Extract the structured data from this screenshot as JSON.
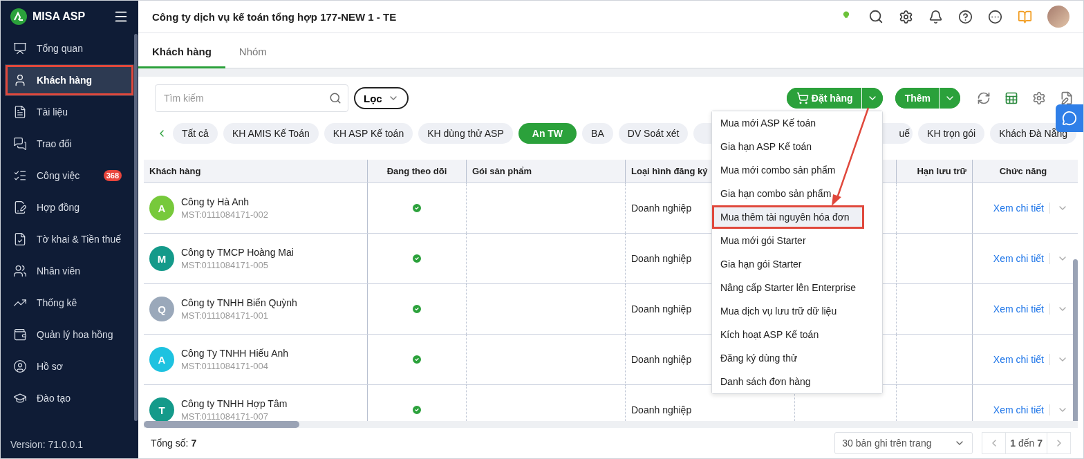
{
  "brand": "MISA ASP",
  "company": "Công ty dịch vụ kế toán tổng hợp 177-NEW 1 - TE",
  "sidebar": {
    "items": [
      {
        "label": "Tổng quan",
        "selected": false
      },
      {
        "label": "Khách hàng",
        "selected": true
      },
      {
        "label": "Tài liệu",
        "selected": false
      },
      {
        "label": "Trao đổi",
        "selected": false
      },
      {
        "label": "Công việc",
        "selected": false,
        "badge": "368"
      },
      {
        "label": "Hợp đồng",
        "selected": false
      },
      {
        "label": "Tờ khai & Tiền thuế",
        "selected": false
      },
      {
        "label": "Nhân viên",
        "selected": false
      },
      {
        "label": "Thống kê",
        "selected": false
      },
      {
        "label": "Quản lý hoa hồng",
        "selected": false
      },
      {
        "label": "Hồ sơ",
        "selected": false
      },
      {
        "label": "Đào tạo",
        "selected": false
      }
    ],
    "version": "Version: 71.0.0.1"
  },
  "tabs": [
    {
      "label": "Khách hàng",
      "selected": true
    },
    {
      "label": "Nhóm",
      "selected": false
    }
  ],
  "search": {
    "placeholder": "Tìm kiếm"
  },
  "filter_button": "Lọc",
  "order_button": "Đặt hàng",
  "add_button": "Thêm",
  "chips": [
    {
      "label": "Tất cả",
      "selected": false
    },
    {
      "label": "KH AMIS Kế Toán",
      "selected": false
    },
    {
      "label": "KH ASP Kế toán",
      "selected": false
    },
    {
      "label": "KH dùng thử ASP",
      "selected": false
    },
    {
      "label": "An TW",
      "selected": true
    },
    {
      "label": "BA",
      "selected": false
    },
    {
      "label": "DV Soát xét",
      "selected": false
    },
    {
      "label": "uế",
      "selected": false,
      "kind": "covered"
    },
    {
      "label": "KH trọn gói",
      "selected": false
    },
    {
      "label": "Khách Đà Nẵng",
      "selected": false
    }
  ],
  "table": {
    "columns": [
      "Khách hàng",
      "Đang theo dõi",
      "Gói sản phẩm",
      "Loại hình đăng ký",
      "Hạn lưu trữ",
      "Chức năng"
    ],
    "rows": [
      {
        "initial": "A",
        "color": "#77c93b",
        "name": "Công ty Hà Anh",
        "tax_id": "MST:0111084171-002",
        "following": true,
        "type": "Doanh nghiệp",
        "action": "Xem chi tiết"
      },
      {
        "initial": "M",
        "color": "#149a8a",
        "name": "Công ty TMCP Hoàng Mai",
        "tax_id": "MST:0111084171-005",
        "following": true,
        "type": "Doanh nghiệp",
        "action": "Xem chi tiết"
      },
      {
        "initial": "Q",
        "color": "#9aa8ba",
        "name": "Công ty TNHH Biển Quỳnh",
        "tax_id": "MST:0111084171-001",
        "following": true,
        "type": "Doanh nghiệp",
        "action": "Xem chi tiết"
      },
      {
        "initial": "A",
        "color": "#1ec2e0",
        "name": "Công Ty TNHH Hiếu Anh",
        "tax_id": "MST:0111084171-004",
        "following": true,
        "type": "Doanh nghiệp",
        "action": "Xem chi tiết"
      },
      {
        "initial": "T",
        "color": "#149a8a",
        "name": "Công ty TNHH Hợp Tâm",
        "tax_id": "MST:0111084171-007",
        "following": true,
        "type": "Doanh nghiệp",
        "action": "Xem chi tiết"
      }
    ]
  },
  "order_menu": {
    "items": [
      {
        "label": "Mua mới ASP Kế toán",
        "highlighted": false
      },
      {
        "label": "Gia hạn ASP Kế toán",
        "highlighted": false
      },
      {
        "label": "Mua mới combo sản phẩm",
        "highlighted": false
      },
      {
        "label": "Gia hạn combo sản phẩm",
        "highlighted": false
      },
      {
        "label": "Mua thêm tài nguyên hóa đơn",
        "highlighted": true
      },
      {
        "label": "Mua mới gói Starter",
        "highlighted": false
      },
      {
        "label": "Gia hạn gói Starter",
        "highlighted": false
      },
      {
        "label": "Nâng cấp Starter lên Enterprise",
        "highlighted": false
      },
      {
        "label": "Mua dịch vụ lưu trữ dữ liệu",
        "highlighted": false
      },
      {
        "label": "Kích hoạt ASP Kế toán",
        "highlighted": false
      },
      {
        "label": "Đăng ký dùng thử",
        "highlighted": false
      },
      {
        "label": "Danh sách đơn hàng",
        "highlighted": false
      }
    ]
  },
  "footer": {
    "total": "Tổng số: **7**",
    "page_size": "30 bản ghi trên trang",
    "pager": "**1** đến **7**"
  }
}
